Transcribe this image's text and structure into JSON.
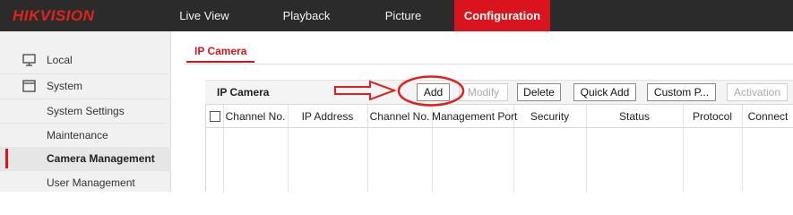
{
  "header": {
    "logo": "HIKVISION",
    "nav": [
      {
        "label": "Live View"
      },
      {
        "label": "Playback"
      },
      {
        "label": "Picture"
      },
      {
        "label": "Configuration",
        "active": true
      }
    ]
  },
  "sidebar": {
    "items": [
      {
        "label": "Local",
        "icon": "monitor-icon"
      },
      {
        "label": "System",
        "icon": "window-icon"
      },
      {
        "label": "System Settings"
      },
      {
        "label": "Maintenance"
      },
      {
        "label": "Camera Management",
        "active": true
      },
      {
        "label": "User Management"
      }
    ]
  },
  "tab": {
    "label": "IP Camera"
  },
  "toolbar": {
    "title": "IP Camera",
    "buttons": [
      {
        "label": "Add",
        "disabled": false
      },
      {
        "label": "Modify",
        "disabled": true
      },
      {
        "label": "Delete",
        "disabled": false
      },
      {
        "label": "Quick Add",
        "disabled": false
      },
      {
        "label": "Custom P...",
        "disabled": false
      },
      {
        "label": "Activation",
        "disabled": true
      }
    ]
  },
  "table": {
    "columns": [
      "Channel No.",
      "IP Address",
      "Channel No.",
      "Management Port",
      "Security",
      "Status",
      "Protocol",
      "Connect"
    ],
    "rows": []
  },
  "colors": {
    "accent": "#d9141c",
    "topbar": "#2b2b2b",
    "annotation": "#e02020"
  }
}
